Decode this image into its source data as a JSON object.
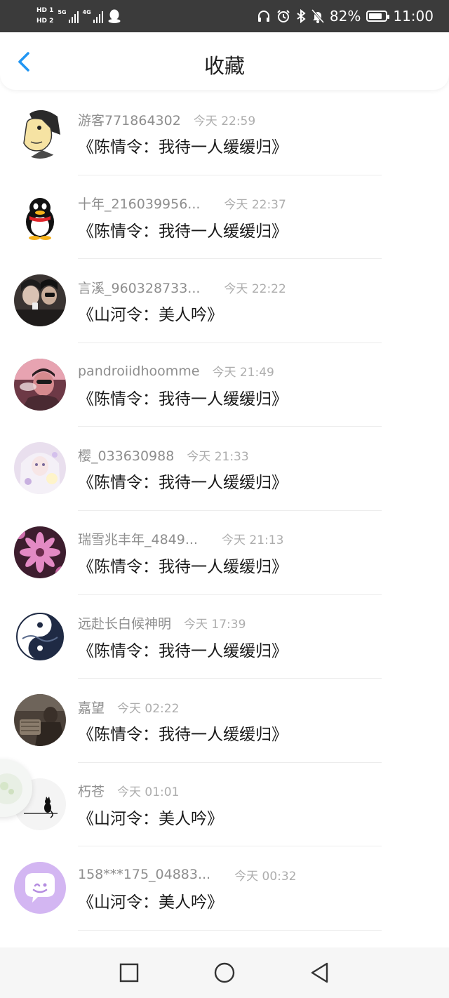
{
  "status_bar": {
    "hd1": "HD 1",
    "hd2": "HD 2",
    "network1": "5G",
    "network2": "4G",
    "battery_percent": "82%",
    "battery_level": 0.82,
    "time": "11:00"
  },
  "header": {
    "title": "收藏"
  },
  "items": [
    {
      "name": "游客771864302",
      "time": "今天 22:59",
      "text": "《陈情令：我待一人缓缓归》",
      "avatar": "cartoon-man-avatar"
    },
    {
      "name": "十年_216039956...",
      "time": "今天 22:37",
      "text": "《陈情令：我待一人缓缓归》",
      "avatar": "penguin-avatar"
    },
    {
      "name": "言溪_960328733...",
      "time": "今天 22:22",
      "text": "《山河令：美人吟》",
      "avatar": "couple-selfie-avatar"
    },
    {
      "name": "pandroiidhoomme",
      "time": "今天 21:49",
      "text": "《陈情令：我待一人缓缓归》",
      "avatar": "smoking-man-avatar"
    },
    {
      "name": "樱_033630988",
      "time": "今天 21:33",
      "text": "《陈情令：我待一人缓缓归》",
      "avatar": "anime-girl-avatar"
    },
    {
      "name": "瑞雪兆丰年_4849...",
      "time": "今天 21:13",
      "text": "《陈情令：我待一人缓缓归》",
      "avatar": "pink-flower-avatar"
    },
    {
      "name": "远赴长白候神明",
      "time": "今天 17:39",
      "text": "《陈情令：我待一人缓缓归》",
      "avatar": "yin-yang-avatar"
    },
    {
      "name": "嘉望",
      "time": "今天 02:22",
      "text": "《陈情令：我待一人缓缓归》",
      "avatar": "dark-photo-avatar"
    },
    {
      "name": "朽苍",
      "time": "今天 01:01",
      "text": "《山河令：美人吟》",
      "avatar": "black-cat-avatar"
    },
    {
      "name": "158***175_04883...",
      "time": "今天 00:32",
      "text": "《山河令：美人吟》",
      "avatar": "chat-bubble-avatar"
    }
  ],
  "colors": {
    "accent": "#2196f3",
    "status_bar_bg": "#3b3b3b",
    "name_text": "#8e8e8e",
    "time_text": "#adadad",
    "message_text": "#1a1a1a"
  }
}
